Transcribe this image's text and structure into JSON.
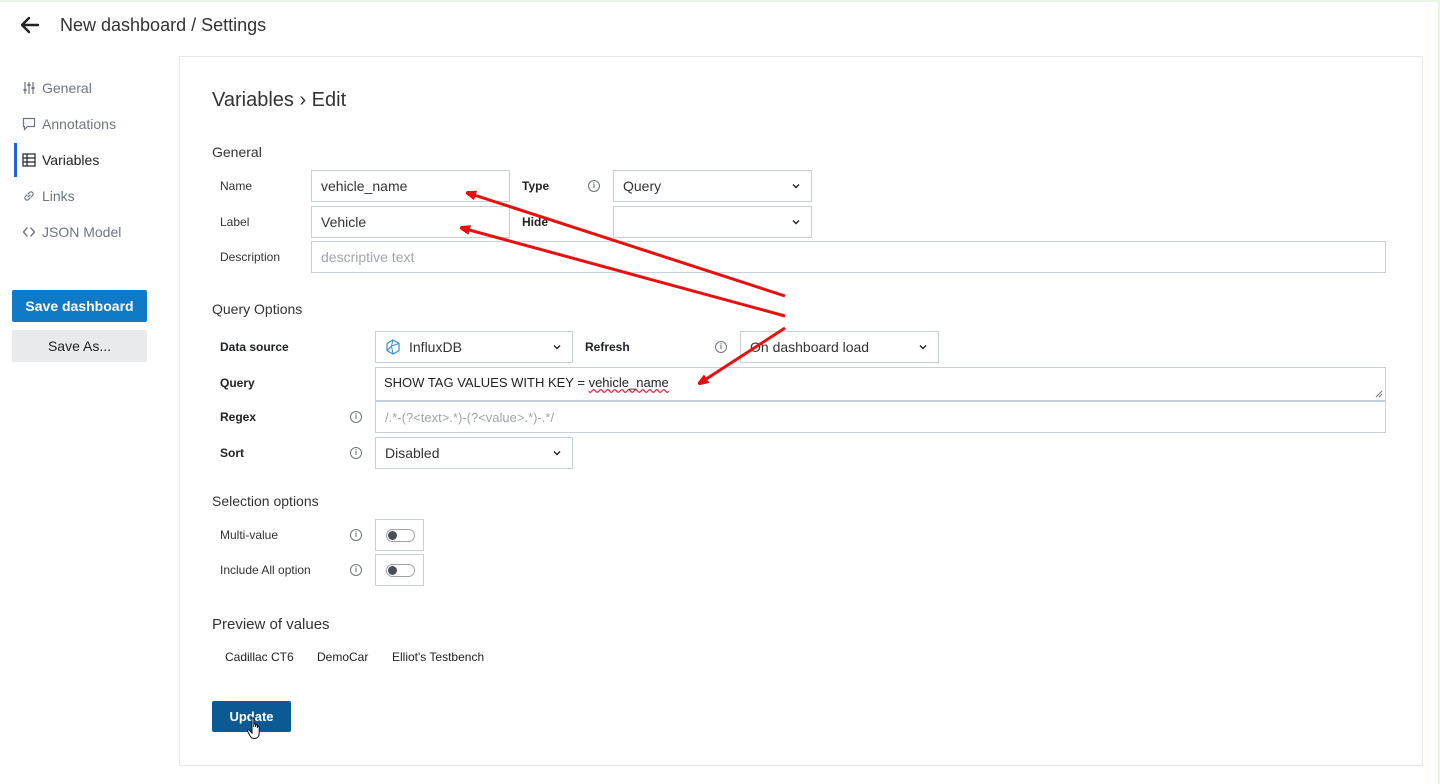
{
  "header": {
    "breadcrumb": "New dashboard / Settings"
  },
  "sidebar": {
    "items": [
      {
        "label": "General",
        "icon": "sliders-icon"
      },
      {
        "label": "Annotations",
        "icon": "comment-icon"
      },
      {
        "label": "Variables",
        "icon": "table-icon",
        "active": true
      },
      {
        "label": "Links",
        "icon": "link-icon"
      },
      {
        "label": "JSON Model",
        "icon": "code-icon"
      }
    ],
    "save_label": "Save dashboard",
    "save_as_label": "Save As..."
  },
  "page": {
    "title": "Variables › Edit"
  },
  "general": {
    "section": "General",
    "name_label": "Name",
    "name_value": "vehicle_name",
    "type_label": "Type",
    "type_value": "Query",
    "label_label": "Label",
    "label_value": "Vehicle",
    "hide_label": "Hide",
    "hide_value": "",
    "description_label": "Description",
    "description_placeholder": "descriptive text"
  },
  "query_options": {
    "section": "Query Options",
    "datasource_label": "Data source",
    "datasource_value": "InfluxDB",
    "refresh_label": "Refresh",
    "refresh_value": "On dashboard load",
    "query_label": "Query",
    "query_prefix": "SHOW TAG VALUES WITH KEY = ",
    "query_key": "vehicle_name",
    "regex_label": "Regex",
    "regex_placeholder": "/.*-(?<text>.*)-(?<value>.*)-.*/",
    "sort_label": "Sort",
    "sort_value": "Disabled"
  },
  "selection": {
    "section": "Selection options",
    "multi_label": "Multi-value",
    "multi_on": false,
    "include_all_label": "Include All option",
    "include_all_on": false
  },
  "preview": {
    "section": "Preview of values",
    "values": [
      "Cadillac CT6",
      "DemoCar",
      "Elliot's Testbench"
    ]
  },
  "update_label": "Update",
  "colors": {
    "primary": "#0f7ac8",
    "update": "#0c5a93",
    "annotation_arrow": "#e8100e",
    "active_nav": "#1f62e0"
  }
}
